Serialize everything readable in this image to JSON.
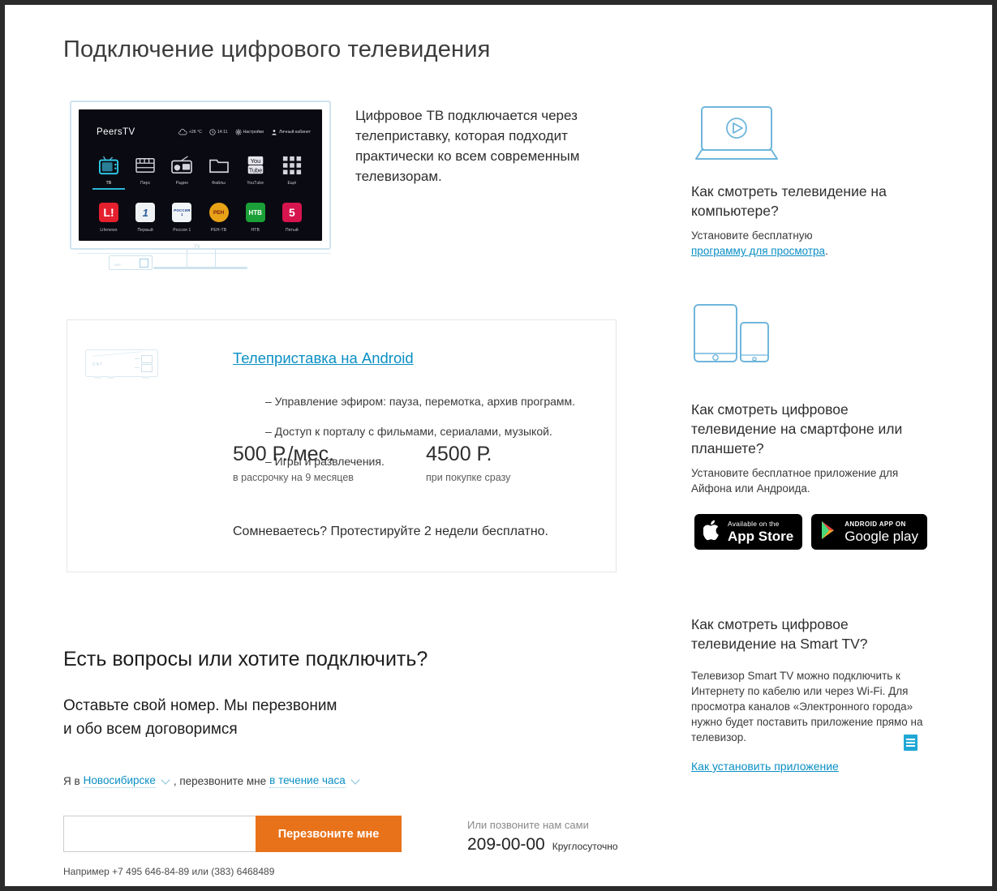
{
  "page": {
    "title": "Подключение цифрового телевидения"
  },
  "tv_preview": {
    "brand": "PeersTV",
    "status": {
      "temperature": "+26 °C",
      "time": "14:11",
      "settings": "Настройки",
      "account": "Личный кабинет"
    },
    "menu": [
      {
        "label": "ТВ",
        "icon": "tv-icon",
        "active": true
      },
      {
        "label": "Пирс",
        "icon": "film-icon",
        "active": false
      },
      {
        "label": "Радио",
        "icon": "radio-icon",
        "active": false
      },
      {
        "label": "Файлы",
        "icon": "folder-icon",
        "active": false
      },
      {
        "label": "YouTube",
        "icon": "youtube-icon",
        "active": false
      },
      {
        "label": "Ещё",
        "icon": "grid-icon",
        "active": false
      }
    ],
    "channels": [
      {
        "label": "Lifenews",
        "logo": "L!",
        "color": "#e5202e",
        "text": "#ffffff"
      },
      {
        "label": "Первый",
        "logo": "1",
        "color": "#eef2f5",
        "text": "#2a5c9b"
      },
      {
        "label": "Россия 1",
        "logo": "РОССИЯ 1",
        "color": "#f2f5f8",
        "text": "#123a86"
      },
      {
        "label": "РЕН-ТВ",
        "logo": "РЕН",
        "color": "#e8a317",
        "text": "#7a1a12"
      },
      {
        "label": "НТВ",
        "logo": "НТВ",
        "color": "#1aa037",
        "text": "#ffffff"
      },
      {
        "label": "Пятый",
        "logo": "5",
        "color": "#d6144e",
        "text": "#ffffff"
      }
    ],
    "stand_label": "TV"
  },
  "intro": {
    "text": "Цифровое ТВ подключается через телеприставку, которая подходит практически ко всем современным телевизорам."
  },
  "product_card": {
    "device_icon_text": "DNT",
    "title": "Телеприставка на Android",
    "features": [
      "– Управление эфиром: пауза, перемотка, архив программ.",
      "– Доступ к порталу с фильмами, сериалами, музыкой.",
      "– Игры и развлечения."
    ],
    "prices": [
      {
        "amount": "500 Р./мес.",
        "note": "в рассрочку на 9 месяцев"
      },
      {
        "amount": "4500 Р.",
        "note": "при покупке сразу"
      }
    ],
    "trial_note": "Сомневаетесь? Протестируйте 2 недели бесплатно."
  },
  "cta": {
    "heading": "Есть вопросы или хотите подключить?",
    "subheading_line1": "Оставьте свой номер. Мы перезвоним",
    "subheading_line2": "и обо всем договоримся",
    "city_prefix": "Я в",
    "city_value": "Новосибирске",
    "callback_mid": ", перезвоните мне",
    "timeframe_value": "в течение часа",
    "phone_placeholder": "",
    "phone_value": "",
    "button_label": "Перезвоните мне",
    "hint": "Например +7 495 646-84-89 или (383) 6468489",
    "call_us_title": "Или позвоните нам сами",
    "call_us_number": "209-00-00",
    "call_us_note": "Круглосуточно"
  },
  "sidebar": {
    "computer": {
      "icon": "laptop-play-icon",
      "heading": "Как смотреть телевидение на компьютере?",
      "text_before": "Установите бесплатную",
      "link": "программу для просмотра",
      "text_after": "."
    },
    "mobile": {
      "icon": "tablet-phone-icon",
      "heading": "Как смотреть цифровое телевидение на смартфоне или планшете?",
      "text": "Установите бесплатное приложение для Айфона или Андроида.",
      "badges": [
        {
          "name": "app-store-badge",
          "small": "Available on the",
          "big": "App Store",
          "icon": "apple-icon"
        },
        {
          "name": "google-play-badge",
          "small": "ANDROID APP ON",
          "big": "Google play",
          "icon": "play-triangle-icon"
        }
      ]
    },
    "smarttv": {
      "heading": "Как смотреть цифровое телевидение на Smart TV?",
      "text": "Телевизор Smart TV можно подключить к Интернету по кабелю или через Wi-Fi. Для просмотра каналов «Электронного города» нужно будет поставить приложение прямо на телевизор.",
      "link": "Как установить приложение",
      "doc_icon": "document-icon"
    }
  },
  "colors": {
    "accent_blue": "#0a8fc4",
    "accent_orange": "#e8721a",
    "tv_outline": "#cfe3ee"
  }
}
